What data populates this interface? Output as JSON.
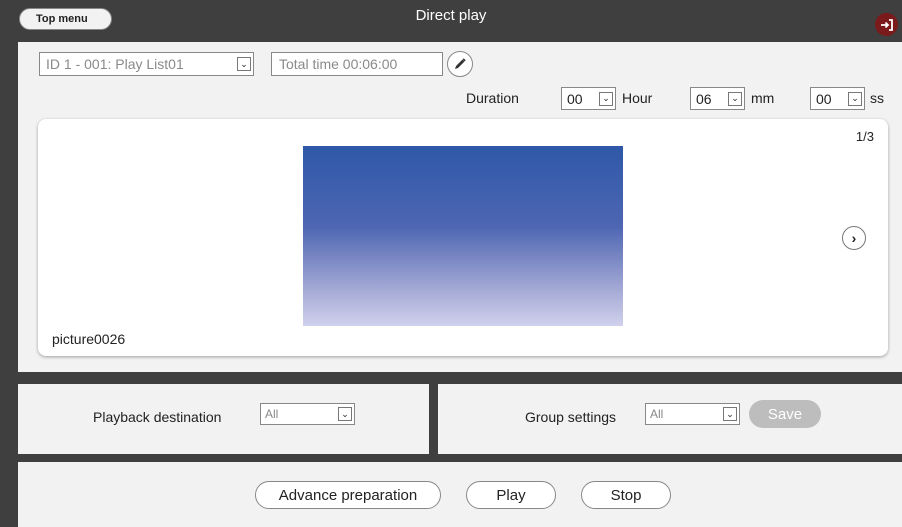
{
  "header": {
    "top_menu_label": "Top menu",
    "title": "Direct play",
    "logout_icon": "logout-icon"
  },
  "playlist": {
    "selected": "ID 1 - 001: Play List01",
    "total_time": "Total time 00:06:00"
  },
  "duration": {
    "label": "Duration",
    "hour_value": "00",
    "hour_label": "Hour",
    "minute_value": "06",
    "minute_label": "mm",
    "second_value": "00",
    "second_label": "ss"
  },
  "preview": {
    "page_indicator": "1/3",
    "file_name": "picture0026"
  },
  "playback": {
    "label": "Playback destination",
    "selected": "All"
  },
  "group": {
    "label": "Group settings",
    "selected": "All",
    "save_label": "Save"
  },
  "actions": {
    "advance_label": "Advance preparation",
    "play_label": "Play",
    "stop_label": "Stop"
  },
  "colors": {
    "background": "#3f3f3f",
    "panel": "#f2f2f2",
    "logout": "#7a1a1a",
    "save_disabled": "#bdbdbd"
  }
}
